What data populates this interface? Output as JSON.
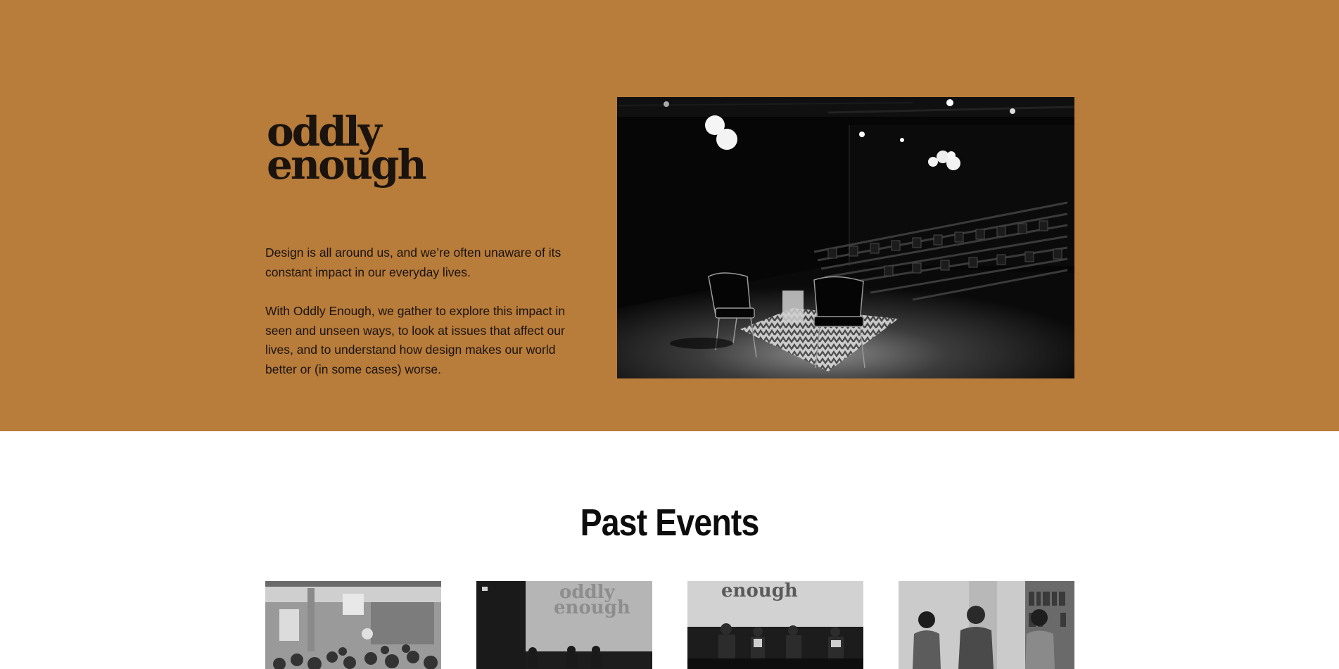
{
  "hero": {
    "logo": {
      "line1": "oddly",
      "line2": "enough"
    },
    "intro": {
      "paragraph1": "Design is all around us, and we’re often unaware of its constant impact in our everyday lives.",
      "paragraph2": "With Oddly Enough, we gather to explore this impact in seen and unseen ways, to look at issues that affect our lives, and to understand how design makes our world better or (in some cases) worse."
    },
    "photo_alt": "Empty auditorium stage with two chairs under spotlights",
    "background_color": "#b87c3b"
  },
  "past_events": {
    "title": "Past Events",
    "cards": [
      {
        "alt": "Audience seated in a lecture hall"
      },
      {
        "alt": "Panel on stage in front of oddly enough projection"
      },
      {
        "alt": "Four speakers seated under enough projection"
      },
      {
        "alt": "Three speakers standing in a library room"
      }
    ],
    "screen_text": {
      "card2_line1": "oddly",
      "card2_line2": "enough",
      "card3": "enough"
    }
  }
}
